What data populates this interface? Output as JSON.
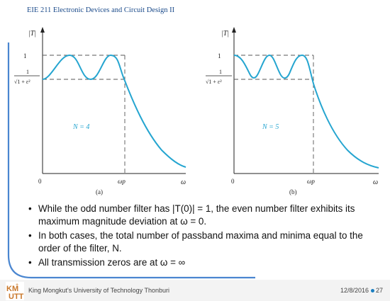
{
  "header": {
    "title": "EIE 211 Electronic Devices and Circuit Design II"
  },
  "figure": {
    "panels": [
      {
        "id": "a",
        "y_axis_label": "|T|",
        "y_tick_top": "1",
        "y_tick_fraction_num": "1",
        "y_tick_fraction_den": "√1 + ε²",
        "origin_label": "0",
        "x_tick_label": "ωp",
        "x_axis_label": "ω",
        "n_label": "N = 4",
        "caption": "(a)"
      },
      {
        "id": "b",
        "y_axis_label": "|T|",
        "y_tick_top": "1",
        "y_tick_fraction_num": "1",
        "y_tick_fraction_den": "√1 + ε²",
        "origin_label": "0",
        "x_tick_label": "ωp",
        "x_axis_label": "ω",
        "n_label": "N = 5",
        "caption": "(b)"
      }
    ],
    "curve_color": "#25a5d0"
  },
  "bullets": [
    "While the odd number filter has |T(0)| = 1, the even number filter exhibits its maximum magnitude deviation at ω = 0.",
    "In both cases, the total number of passband maxima and minima equal to the order of the filter, N.",
    "All transmission zeros are at ω = ∞"
  ],
  "footer": {
    "logo_text": "KMUTT",
    "institution": "King Mongkut's University of Technology Thonburi",
    "date": "12/8/2016",
    "page": "27"
  },
  "colors": {
    "accent": "#4a86d0",
    "footer_bg": "#f3f3f3"
  }
}
